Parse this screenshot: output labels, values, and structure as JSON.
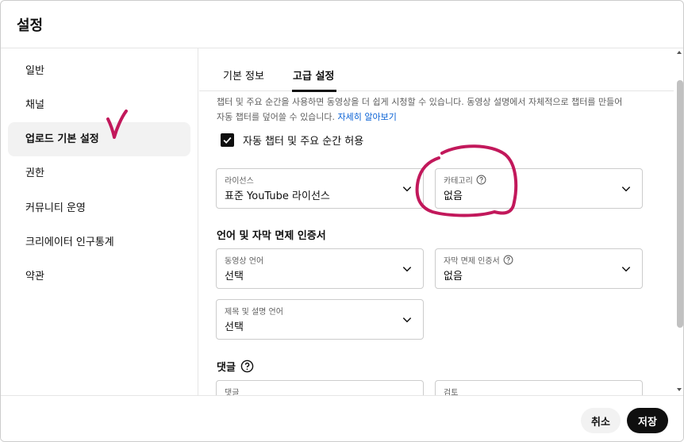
{
  "dialog": {
    "title": "설정"
  },
  "sidebar": {
    "items": [
      {
        "label": "일반"
      },
      {
        "label": "채널"
      },
      {
        "label": "업로드 기본 설정"
      },
      {
        "label": "권한"
      },
      {
        "label": "커뮤니티 운영"
      },
      {
        "label": "크리에이터 인구통계"
      },
      {
        "label": "약관"
      }
    ]
  },
  "tabs": [
    {
      "label": "기본 정보"
    },
    {
      "label": "고급 설정"
    }
  ],
  "chapters": {
    "description_line1": "챕터 및 주요 순간을 사용하면 동영상을 더 쉽게 시청할 수 있습니다. 동영상 설명에서 자체적으로 챕터를 만들어",
    "description_line2": "자동 챕터를 덮어쓸 수 있습니다. ",
    "learn_more": "자세히 알아보기",
    "checkbox_label": "자동 챕터 및 주요 순간 허용",
    "checkbox_checked": true
  },
  "fields": {
    "license": {
      "label": "라이선스",
      "value": "표준 YouTube 라이선스"
    },
    "category": {
      "label": "카테고리",
      "value": "없음"
    },
    "video_language": {
      "label": "동영상 언어",
      "value": "선택"
    },
    "caption_cert": {
      "label": "자막 면제 인증서",
      "value": "없음"
    },
    "title_desc_language": {
      "label": "제목 및 설명 언어",
      "value": "선택"
    },
    "comments": {
      "label": "댓글"
    },
    "review": {
      "label": "검토"
    }
  },
  "sections": {
    "language_title": "언어 및 자막 면제 인증서",
    "comments_title": "댓글"
  },
  "footer": {
    "cancel_label": "취소",
    "save_label": "저장"
  },
  "colors": {
    "annotation": "#c2185b",
    "link": "#065fd4",
    "primary": "#0f0f0f"
  },
  "icons": {
    "chevron": "chevron-down-icon",
    "help": "help-circle-icon",
    "check": "check-icon"
  }
}
